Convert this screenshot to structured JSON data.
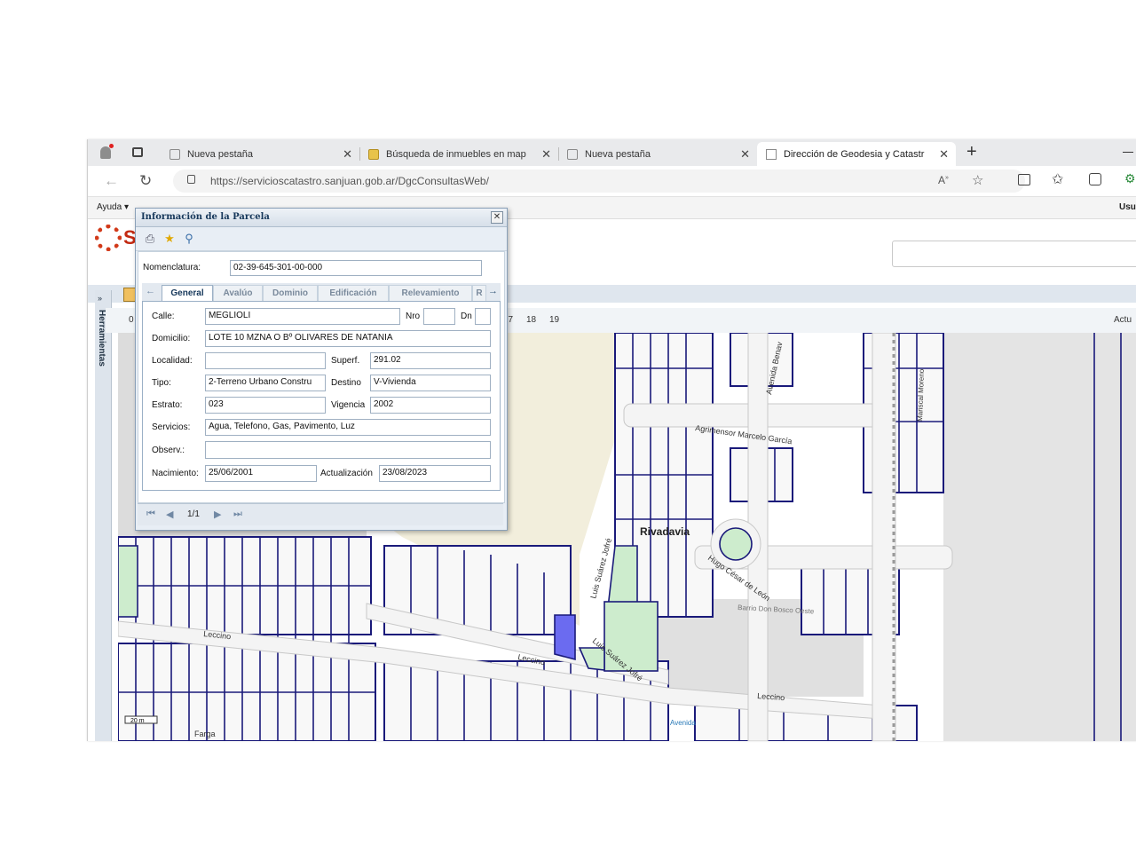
{
  "browser": {
    "tabs": [
      {
        "label": "Nueva pestaña"
      },
      {
        "label": "Búsqueda de inmuebles en map"
      },
      {
        "label": "Nueva pestaña"
      },
      {
        "label": "Dirección de Geodesia y Catastr"
      }
    ],
    "new_tab": "+",
    "url": "https://servicioscatastro.sanjuan.gob.ar/DgcConsultasWeb/"
  },
  "site": {
    "menu": {
      "ayuda": "Ayuda ▾",
      "usuario": "Usu"
    },
    "sidebar_label": "Herramientas",
    "zoom_levels": [
      "17",
      "18",
      "19"
    ],
    "zoom_left": "0",
    "right_label": "Actu"
  },
  "dialog": {
    "title": "Información de la Parcela",
    "nomenclatura_label": "Nomenclatura:",
    "nomenclatura_value": "02-39-645-301-00-000",
    "tabs": [
      "General",
      "Avalúo",
      "Dominio",
      "Edificación",
      "Relevamiento",
      "R"
    ],
    "fields": {
      "calle_label": "Calle:",
      "calle": "MEGLIOLI",
      "nro_label": "Nro",
      "nro": "",
      "dn_label": "Dn",
      "dn": "",
      "domicilio_label": "Domicilio:",
      "domicilio": "LOTE 10  MZNA O Bº OLIVARES DE NATANIA",
      "localidad_label": "Localidad:",
      "localidad": "",
      "superf_label": "Superf.",
      "superf": "291.02",
      "tipo_label": "Tipo:",
      "tipo": "2-Terreno Urbano Constru",
      "destino_label": "Destino",
      "destino": "V-Vivienda",
      "estrato_label": "Estrato:",
      "estrato": "023",
      "vigencia_label": "Vigencia",
      "vigencia": "2002",
      "servicios_label": "Servicios:",
      "servicios": "Agua, Telefono, Gas, Pavimento, Luz",
      "observ_label": "Observ.:",
      "observ": "",
      "nacimiento_label": "Nacimiento:",
      "nacimiento": "25/06/2001",
      "actualizacion_label": "Actualización",
      "actualizacion": "23/08/2023"
    },
    "pager": "1/1"
  },
  "map": {
    "labels": {
      "rivadavia": "Rivadavia",
      "avenida_benavidez": "Avenida Benav",
      "agrimensor": "Agrimensor Marcelo García",
      "hugo": "Hugo César de León",
      "luis_suarez_1": "Luis Suárez Jofré",
      "luis_suarez_2": "Luis Suárez Jofré",
      "leccino_1": "Leccino",
      "leccino_2": "Leccino",
      "leccino_3": "Leccino",
      "farga": "Farga",
      "mariscal": "Mariscal Moreno",
      "barrio": "Barrio Don Bosco Oeste",
      "avenida_small": "Avenida",
      "scale": "20 m"
    }
  },
  "colors": {
    "parcel_line": "#1a1a7a",
    "selected": "#6b6bf0",
    "green": "#cdeccd",
    "road": "#f4f4f4"
  }
}
